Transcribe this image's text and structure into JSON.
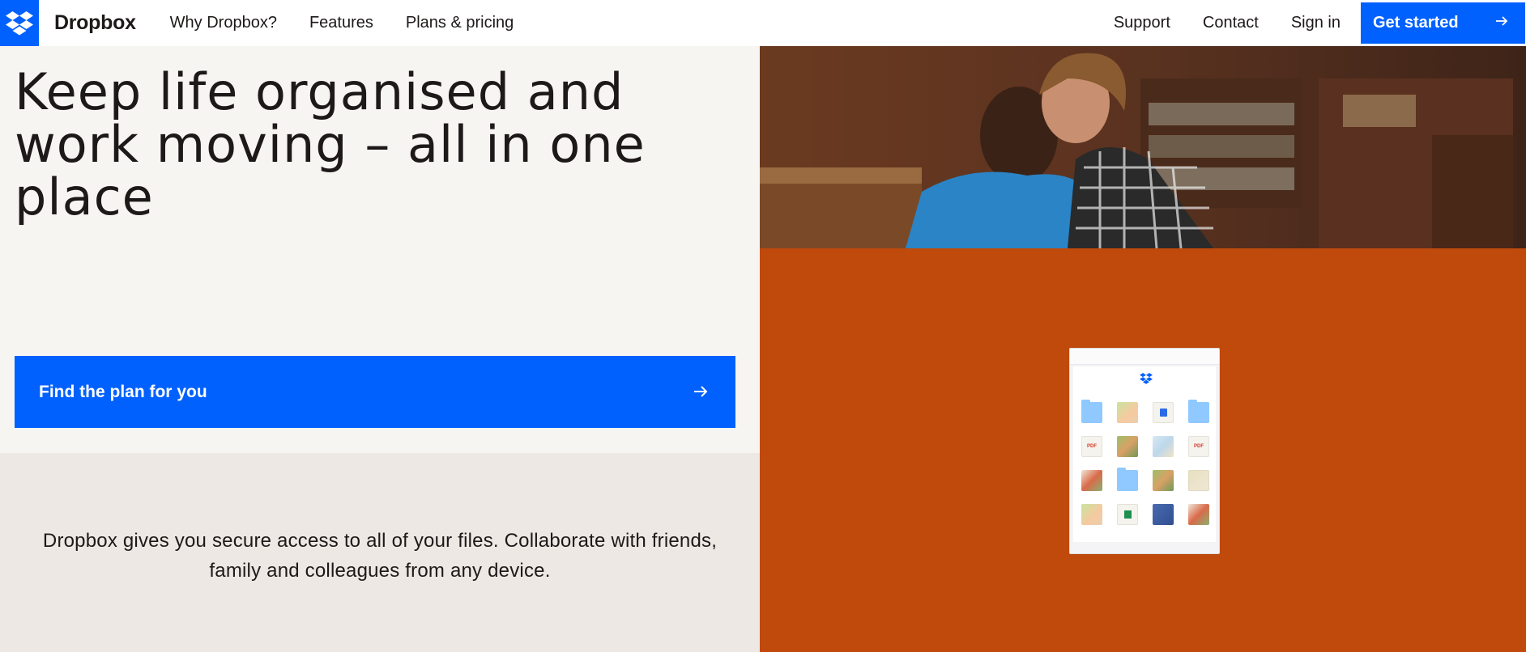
{
  "header": {
    "brand": "Dropbox",
    "nav_left": [
      "Why Dropbox?",
      "Features",
      "Plans & pricing"
    ],
    "nav_right": [
      "Support",
      "Contact",
      "Sign in"
    ],
    "cta_label": "Get started"
  },
  "hero": {
    "headline": "Keep life organised and work moving – all in one place",
    "plan_button_label": "Find the plan for you",
    "description": "Dropbox gives you secure access to all of your files. Collaborate with friends, family and colleagues from any device."
  },
  "app_preview": {
    "tiles": [
      {
        "type": "folder"
      },
      {
        "type": "img1"
      },
      {
        "type": "blue"
      },
      {
        "type": "folder"
      },
      {
        "type": "pdf",
        "label": "PDF"
      },
      {
        "type": "img2"
      },
      {
        "type": "img3"
      },
      {
        "type": "pdf",
        "label": "PDF"
      },
      {
        "type": "img5"
      },
      {
        "type": "folder"
      },
      {
        "type": "img2"
      },
      {
        "type": "img4"
      },
      {
        "type": "img1"
      },
      {
        "type": "xls"
      },
      {
        "type": "img6"
      },
      {
        "type": "img5"
      }
    ]
  },
  "colors": {
    "brand_blue": "#0061fe",
    "hero_bg": "#f7f5f2",
    "info_bg": "#ede8e3",
    "accent_orange": "#bf4a0b"
  },
  "icons": [
    "dropbox-logo-icon",
    "arrow-right-icon"
  ]
}
